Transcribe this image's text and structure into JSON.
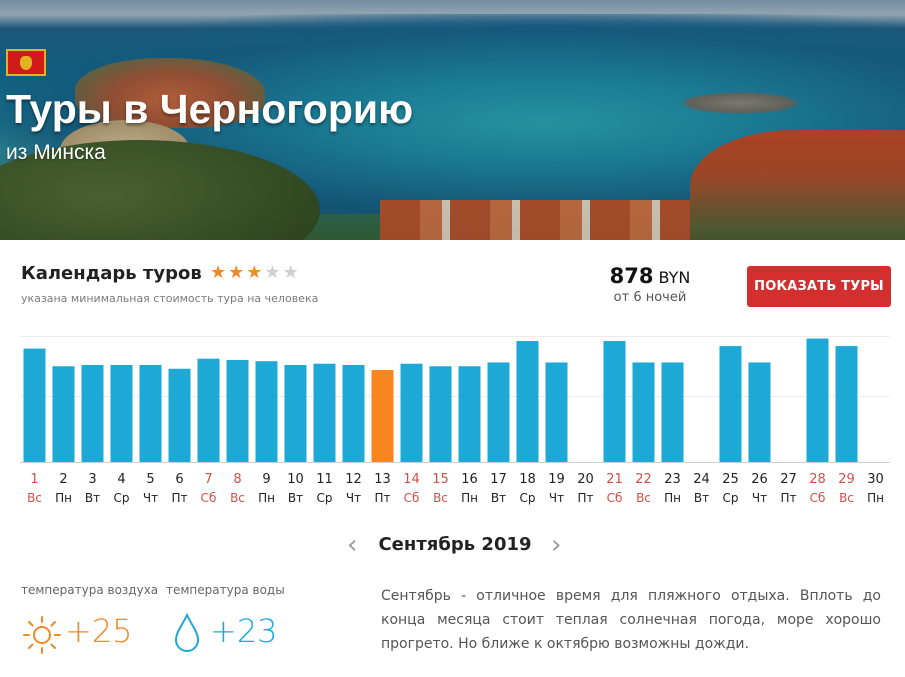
{
  "hero": {
    "title": "Туры в Черногорию",
    "subtitle": "из Минска",
    "flag_icon": "montenegro-flag-icon"
  },
  "calendar": {
    "title": "Календарь туров",
    "rating": 3,
    "rating_max": 5,
    "note": "указана минимальная стоимость тура на человека",
    "price_amount": "878",
    "price_currency": "BYN",
    "price_nights": "от 6 ночей",
    "show_button": "ПОКАЗАТЬ ТУРЫ"
  },
  "colors": {
    "bar": "#1da8d6",
    "bar_selected": "#f7861f",
    "weekend": "#d0504a",
    "accent": "#d32f2f"
  },
  "chart_data": {
    "type": "bar",
    "selected_day": 13,
    "categories": [
      "1",
      "2",
      "3",
      "4",
      "5",
      "6",
      "7",
      "8",
      "9",
      "10",
      "11",
      "12",
      "13",
      "14",
      "15",
      "16",
      "17",
      "18",
      "19",
      "20",
      "21",
      "22",
      "23",
      "24",
      "25",
      "26",
      "27",
      "28",
      "29",
      "30"
    ],
    "weekdays": [
      "Вс",
      "Пн",
      "Вт",
      "Ср",
      "Чт",
      "Пт",
      "Сб",
      "Вс",
      "Пн",
      "Вт",
      "Ср",
      "Чт",
      "Пт",
      "Сб",
      "Вс",
      "Пн",
      "Вт",
      "Ср",
      "Чт",
      "Пт",
      "Сб",
      "Вс",
      "Пн",
      "Вт",
      "Ср",
      "Чт",
      "Пт",
      "Сб",
      "Вс",
      "Пн"
    ],
    "weekend": [
      true,
      false,
      false,
      false,
      false,
      false,
      true,
      true,
      false,
      false,
      false,
      false,
      false,
      true,
      true,
      false,
      false,
      false,
      false,
      false,
      true,
      true,
      false,
      false,
      false,
      false,
      false,
      true,
      true,
      false
    ],
    "values": [
      0.9,
      0.76,
      0.77,
      0.77,
      0.77,
      0.74,
      0.82,
      0.81,
      0.8,
      0.77,
      0.78,
      0.77,
      0.73,
      0.78,
      0.76,
      0.76,
      0.79,
      0.96,
      0.79,
      0,
      0.96,
      0.79,
      0.79,
      0,
      0.92,
      0.79,
      0,
      0.98,
      0.92,
      0
    ],
    "ylim": [
      0,
      1
    ],
    "grid": true
  },
  "month_nav": {
    "label": "Сентябрь 2019",
    "prev_icon": "chevron-left-icon",
    "next_icon": "chevron-right-icon"
  },
  "weather": {
    "air_label": "температура воздуха",
    "water_label": "температура воды",
    "air_temp": "+25",
    "water_temp": "+23",
    "air_icon": "sun-icon",
    "water_icon": "water-drop-icon"
  },
  "description": "Сентябрь - отличное время для пляжного отдыха. Вплоть до конца месяца стоит теплая солнечная погода, море хорошо прогрето. Но ближе к октябрю возможны дожди."
}
